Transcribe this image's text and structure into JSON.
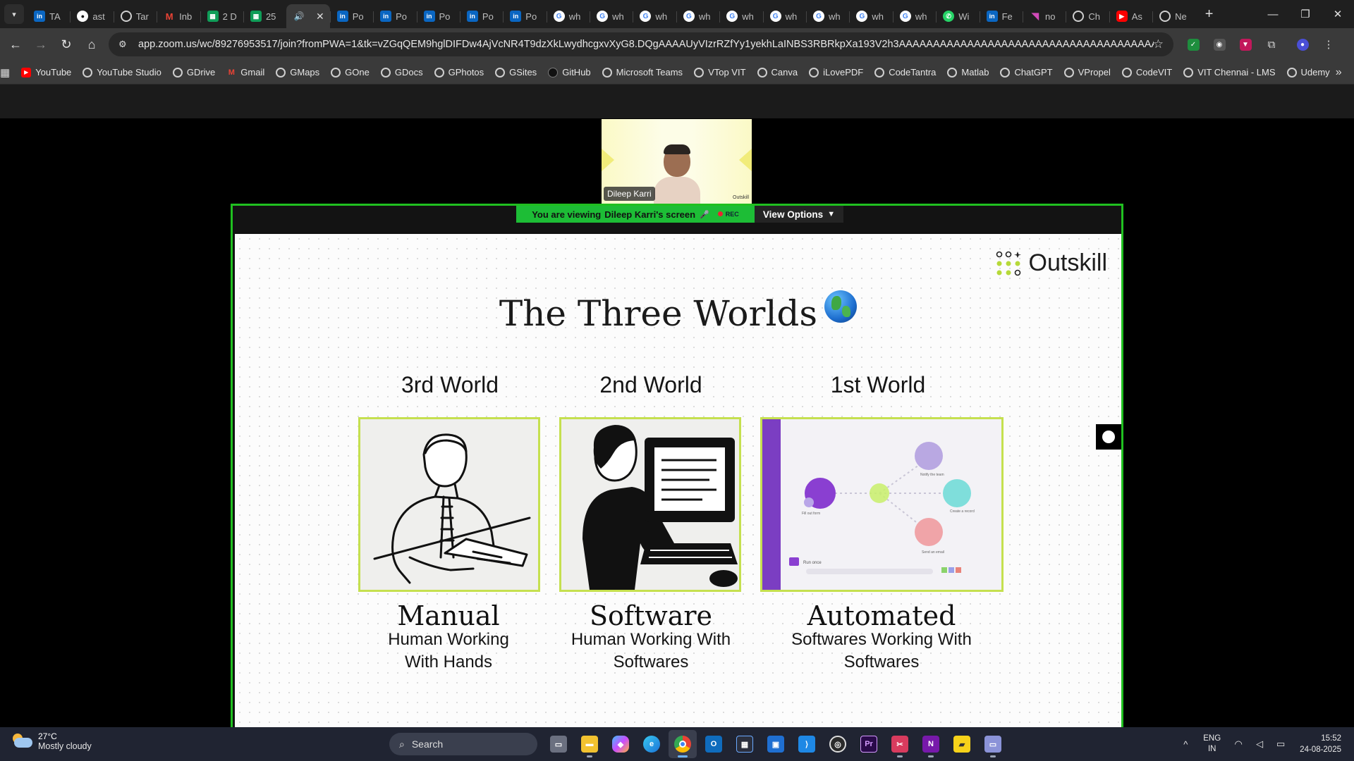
{
  "browser": {
    "tabs": [
      {
        "title": "TA",
        "icon": "linkedin-icon"
      },
      {
        "title": "ast",
        "icon": "github-icon"
      },
      {
        "title": "Tar",
        "icon": "globe-icon"
      },
      {
        "title": "Inb",
        "icon": "gmail-icon"
      },
      {
        "title": "2 D",
        "icon": "sheets-icon"
      },
      {
        "title": "25",
        "icon": "sheets-icon"
      },
      {
        "title": "",
        "icon": "audio-icon",
        "active": true
      },
      {
        "title": "Po",
        "icon": "linkedin-icon"
      },
      {
        "title": "Po",
        "icon": "linkedin-icon"
      },
      {
        "title": "Po",
        "icon": "linkedin-icon"
      },
      {
        "title": "Po",
        "icon": "linkedin-icon"
      },
      {
        "title": "Po",
        "icon": "linkedin-icon"
      },
      {
        "title": "wh",
        "icon": "google-icon"
      },
      {
        "title": "wh",
        "icon": "google-icon"
      },
      {
        "title": "wh",
        "icon": "google-icon"
      },
      {
        "title": "wh",
        "icon": "google-icon"
      },
      {
        "title": "wh",
        "icon": "google-icon"
      },
      {
        "title": "wh",
        "icon": "google-icon"
      },
      {
        "title": "wh",
        "icon": "google-icon"
      },
      {
        "title": "wh",
        "icon": "google-icon"
      },
      {
        "title": "wh",
        "icon": "google-icon"
      },
      {
        "title": "Wi",
        "icon": "whatsapp-icon"
      },
      {
        "title": "Fe",
        "icon": "linkedin-icon"
      },
      {
        "title": "no",
        "icon": "pink-app-icon"
      },
      {
        "title": "Ch",
        "icon": "chatgpt-icon"
      },
      {
        "title": "As",
        "icon": "youtube-icon"
      },
      {
        "title": "Ne",
        "icon": "chatgpt-icon"
      }
    ],
    "url": "app.zoom.us/wc/89276953517/join?fromPWA=1&tk=vZGqQEM9hglDIFDw4AjVcNR4T9dzXkLwydhcgxvXyG8.DQgAAAAUyVIzrRZfYy1yekhLaINBS3RBRkpXa193V2h3AAAAAAAAAAAAAAAAAAAAAAAAAAAAAAAAAAAAAA&_x_zm_r...",
    "bookmarks": [
      {
        "label": "YouTube",
        "icon": "youtube-icon"
      },
      {
        "label": "YouTube Studio",
        "icon": "globe-icon"
      },
      {
        "label": "GDrive",
        "icon": "globe-icon"
      },
      {
        "label": "Gmail",
        "icon": "gmail-icon"
      },
      {
        "label": "GMaps",
        "icon": "globe-icon"
      },
      {
        "label": "GOne",
        "icon": "globe-icon"
      },
      {
        "label": "GDocs",
        "icon": "globe-icon"
      },
      {
        "label": "GPhotos",
        "icon": "globe-icon"
      },
      {
        "label": "GSites",
        "icon": "globe-icon"
      },
      {
        "label": "GitHub",
        "icon": "github-icon"
      },
      {
        "label": "Microsoft Teams",
        "icon": "globe-icon"
      },
      {
        "label": "VTop VIT",
        "icon": "globe-icon"
      },
      {
        "label": "Canva",
        "icon": "globe-icon"
      },
      {
        "label": "iLovePDF",
        "icon": "globe-icon"
      },
      {
        "label": "CodeTantra",
        "icon": "globe-icon"
      },
      {
        "label": "Matlab",
        "icon": "globe-icon"
      },
      {
        "label": "ChatGPT",
        "icon": "chatgpt-icon"
      },
      {
        "label": "VPropel",
        "icon": "globe-icon"
      },
      {
        "label": "CodeVIT",
        "icon": "globe-icon"
      },
      {
        "label": "VIT Chennai - LMS",
        "icon": "globe-icon"
      },
      {
        "label": "Udemy",
        "icon": "globe-icon"
      }
    ]
  },
  "zoom": {
    "participant_name": "Dileep Karri",
    "video_logo_text": "Outskill",
    "share_banner": {
      "prefix": "You are viewing",
      "name": "Dileep Karri's screen",
      "rec": "REC"
    },
    "view_options": "View Options"
  },
  "slide": {
    "brand": "Outskill",
    "title": "The Three Worlds",
    "columns": [
      {
        "heading": "3rd World",
        "name": "Manual",
        "description": "Human Working With Hands"
      },
      {
        "heading": "2nd World",
        "name": "Software",
        "description": "Human Working With Softwares"
      },
      {
        "heading": "1st World",
        "name": "Automated",
        "description": "Softwares Working With Softwares"
      }
    ],
    "workflow_labels": [
      "Fill out form",
      "Notify the team",
      "Create a record",
      "Send an email",
      "Run once"
    ],
    "colors": {
      "card_border": "#c5e04f",
      "frame_border": "#20c020",
      "banner": "#1dbd36"
    }
  },
  "taskbar": {
    "weather": {
      "temp": "27°C",
      "desc": "Mostly cloudy"
    },
    "search_placeholder": "Search",
    "lang": "ENG",
    "region": "IN",
    "time": "15:52",
    "date": "24-08-2025"
  }
}
